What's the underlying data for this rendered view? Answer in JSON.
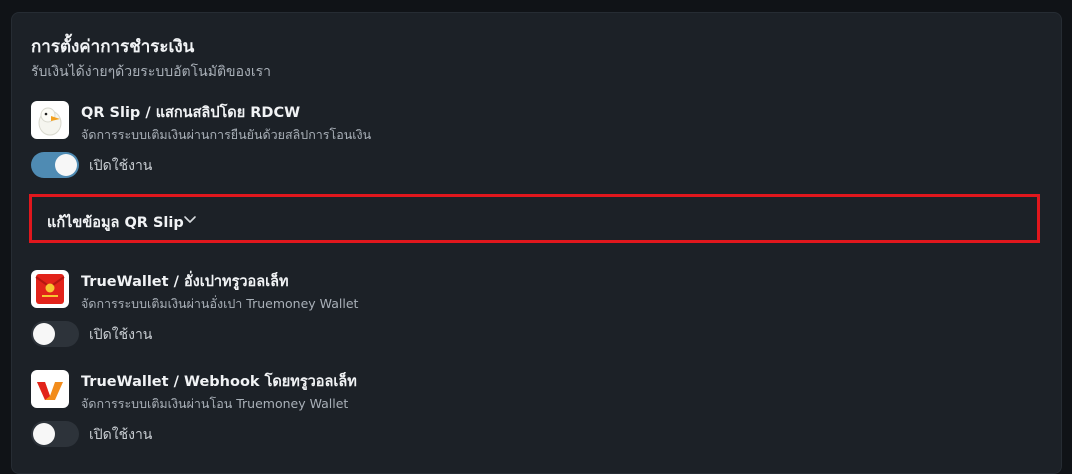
{
  "header": {
    "title": "การตั้งค่าการชำระเงิน",
    "subtitle": "รับเงินได้ง่ายๆด้วยระบบอัตโนมัติของเรา"
  },
  "methods": [
    {
      "name": "QR Slip / แสกนสลิปโดย RDCW",
      "description": "จัดการระบบเติมเงินผ่านการยืนยันด้วยสลิปการโอนเงิน",
      "toggle_label": "เปิดใช้งาน",
      "enabled": true,
      "icon": "duck-logo-icon"
    },
    {
      "name": "TrueWallet / อั่งเปาทรูวอลเล็ท",
      "description": "จัดการระบบเติมเงินผ่านอั่งเปา Truemoney Wallet",
      "toggle_label": "เปิดใช้งาน",
      "enabled": false,
      "icon": "red-envelope-icon"
    },
    {
      "name": "TrueWallet / Webhook โดยทรูวอลเล็ท",
      "description": "จัดการระบบเติมเงินผ่านโอน Truemoney Wallet",
      "toggle_label": "เปิดใช้งาน",
      "enabled": false,
      "icon": "truemoney-wallet-icon"
    }
  ],
  "qr_edit": {
    "label": "แก้ไขข้อมูล QR Slip",
    "icon": "chevron-down-icon"
  },
  "colors": {
    "background": "#101317",
    "panel": "#1c2127",
    "toggle_on": "#4f8bb3",
    "toggle_off": "#2d333a",
    "highlight_border": "#e0171d"
  }
}
